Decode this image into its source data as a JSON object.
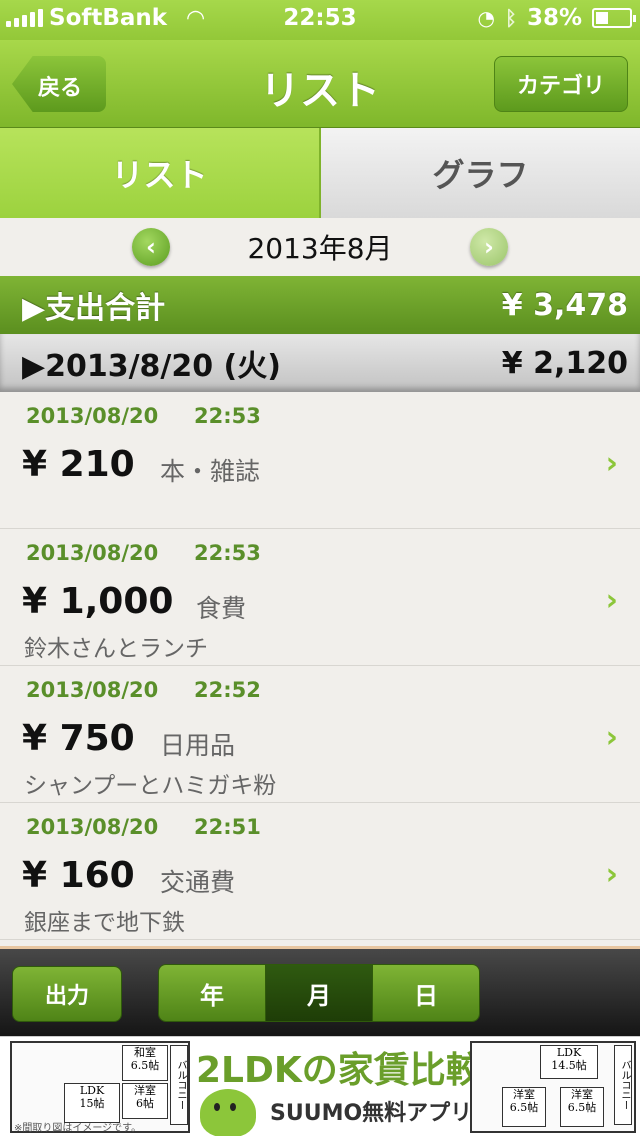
{
  "status": {
    "carrier": "SoftBank",
    "time": "22:53",
    "battery": "38%",
    "battery_level": 0.38
  },
  "nav": {
    "back_label": "戻る",
    "title": "リスト",
    "category_label": "カテゴリ"
  },
  "tabs": [
    {
      "label": "リスト",
      "active": true
    },
    {
      "label": "グラフ",
      "active": false
    }
  ],
  "month_nav": {
    "month": "2013年8月"
  },
  "total": {
    "label": "▶支出合計",
    "amount": "¥ 3,478"
  },
  "day_group": {
    "label": "▶2013/8/20 (火)",
    "amount": "¥ 2,120"
  },
  "entries": [
    {
      "date": "2013/08/20",
      "time": "22:53",
      "amount": "¥ 210",
      "category": "本・雑誌",
      "memo": ""
    },
    {
      "date": "2013/08/20",
      "time": "22:53",
      "amount": "¥ 1,000",
      "category": "食費",
      "memo": "鈴木さんとランチ"
    },
    {
      "date": "2013/08/20",
      "time": "22:52",
      "amount": "¥ 750",
      "category": "日用品",
      "memo": "シャンプーとハミガキ粉"
    },
    {
      "date": "2013/08/20",
      "time": "22:51",
      "amount": "¥ 160",
      "category": "交通費",
      "memo": "銀座まで地下鉄"
    }
  ],
  "toolbar": {
    "export_label": "出力",
    "periods": [
      {
        "label": "年",
        "active": false
      },
      {
        "label": "月",
        "active": true
      },
      {
        "label": "日",
        "active": false
      }
    ]
  },
  "ad": {
    "headline": "2LDKの家賃比較",
    "sub": "SUUMO無料アプリ",
    "note": "※間取り図はイメージです。",
    "left_plan": {
      "room1": "和室\n6.5帖",
      "room2": "LDK\n15帖",
      "room3": "洋室\n6帖",
      "balcony": "バルコニー"
    },
    "right_plan": {
      "room1": "LDK\n14.5帖",
      "room2": "洋室\n6.5帖",
      "room3": "洋室\n6.5帖",
      "balcony": "バルコニー"
    }
  },
  "colors": {
    "brand_green": "#8cc63a",
    "dark_green": "#5b8f1f",
    "date_green": "#5a8f2a"
  }
}
